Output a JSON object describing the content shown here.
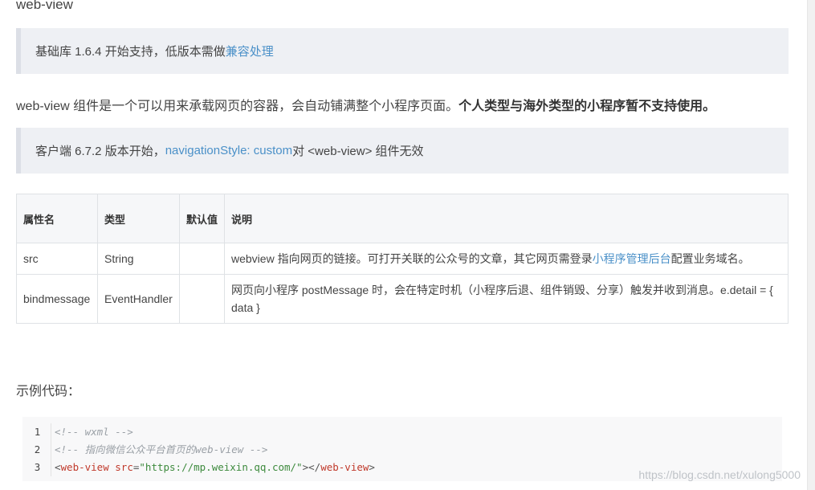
{
  "title": "web-view",
  "tip1": {
    "prefix": "基础库 1.6.4 开始支持，低版本需做",
    "link": "兼容处理"
  },
  "description": {
    "text": "web-view 组件是一个可以用来承载网页的容器，会自动铺满整个小程序页面。",
    "bold": "个人类型与海外类型的小程序暂不支持使用。"
  },
  "tip2": {
    "prefix": "客户端 6.7.2 版本开始，",
    "link": "navigationStyle: custom",
    "suffix": " 对 <web-view> 组件无效"
  },
  "table": {
    "headers": [
      "属性名",
      "类型",
      "默认值",
      "说明"
    ],
    "rows": [
      {
        "name": "src",
        "type": "String",
        "default": "",
        "desc_prefix": "webview 指向网页的链接。可打开关联的公众号的文章，其它网页需登录",
        "desc_link": "小程序管理后台",
        "desc_suffix": "配置业务域名。"
      },
      {
        "name": "bindmessage",
        "type": "EventHandler",
        "default": "",
        "desc_prefix": "网页向小程序 postMessage 时，会在特定时机（小程序后退、组件销毁、分享）触发并收到消息。e.detail = { data }",
        "desc_link": "",
        "desc_suffix": ""
      }
    ]
  },
  "example_label": "示例代码：",
  "code": {
    "line_numbers": [
      "1",
      "2",
      "3"
    ],
    "comment1": "<!-- wxml -->",
    "comment2": "<!-- 指向微信公众平台首页的web-view -->",
    "line3": {
      "open_lt": "<",
      "tag": "web-view",
      "attr": "src",
      "eq": "=",
      "value": "\"https://mp.weixin.qq.com/\"",
      "close_gt": ">",
      "end_lt": "</",
      "end_tag": "web-view",
      "end_gt": ">"
    }
  },
  "watermark": "https://blog.csdn.net/xulong5000"
}
